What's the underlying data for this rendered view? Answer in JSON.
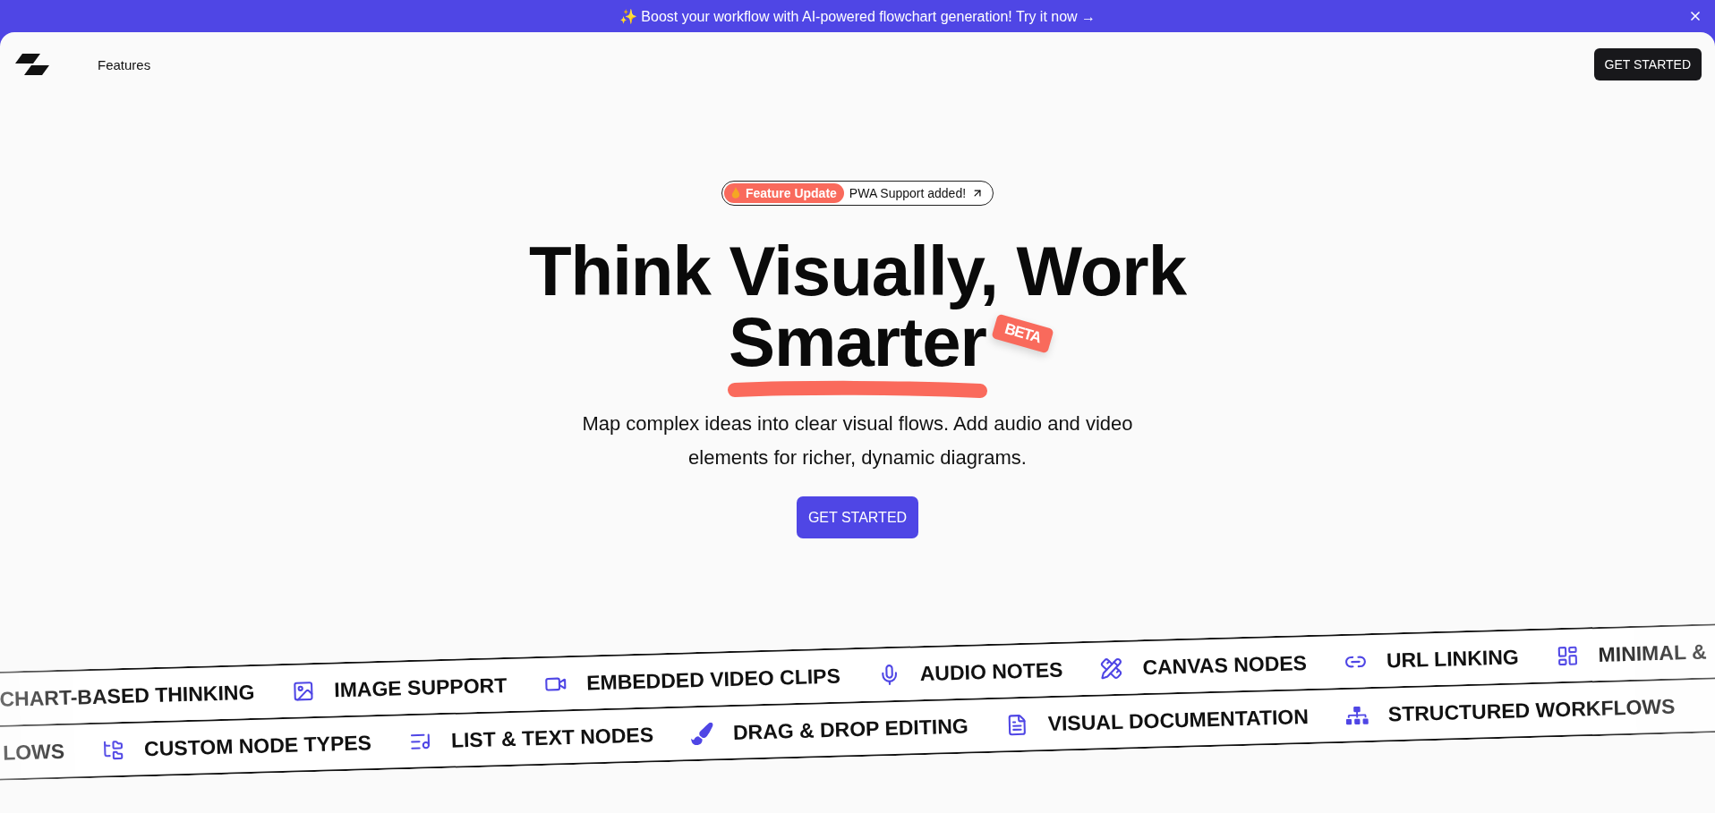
{
  "announcement": {
    "text": "✨ Boost your workflow with AI-powered flowchart generation! Try it now →"
  },
  "nav": {
    "links": [
      "Features"
    ],
    "cta": "GET STARTED"
  },
  "hero": {
    "badge": {
      "tag": "Feature Update",
      "text": "PWA Support added!"
    },
    "title_lines": [
      "Think Visually, Work",
      "Smarter"
    ],
    "beta": "BETA",
    "subtitle": "Map complex ideas into clear visual flows. Add audio and video elements for richer, dynamic diagrams.",
    "cta": "GET STARTED"
  },
  "marquee_rows": [
    {
      "items": [
        {
          "kind": "cut",
          "label": "CHART-BASED THINKING"
        },
        {
          "kind": "feature",
          "label": "IMAGE SUPPORT"
        },
        {
          "kind": "feature",
          "label": "EMBEDDED VIDEO CLIPS"
        },
        {
          "kind": "feature",
          "label": "AUDIO NOTES"
        },
        {
          "kind": "feature",
          "label": "CANVAS NODES"
        },
        {
          "kind": "feature",
          "label": "URL LINKING"
        },
        {
          "kind": "feature",
          "label": "MINIMAL &"
        }
      ]
    },
    {
      "items": [
        {
          "kind": "cut",
          "label": "LOWS"
        },
        {
          "kind": "feature",
          "label": "CUSTOM NODE TYPES"
        },
        {
          "kind": "feature",
          "label": "LIST & TEXT NODES"
        },
        {
          "kind": "feature",
          "label": "DRAG & DROP EDITING"
        },
        {
          "kind": "feature",
          "label": "VISUAL DOCUMENTATION"
        },
        {
          "kind": "feature",
          "label": "STRUCTURED WORKFLOWS"
        }
      ]
    }
  ]
}
